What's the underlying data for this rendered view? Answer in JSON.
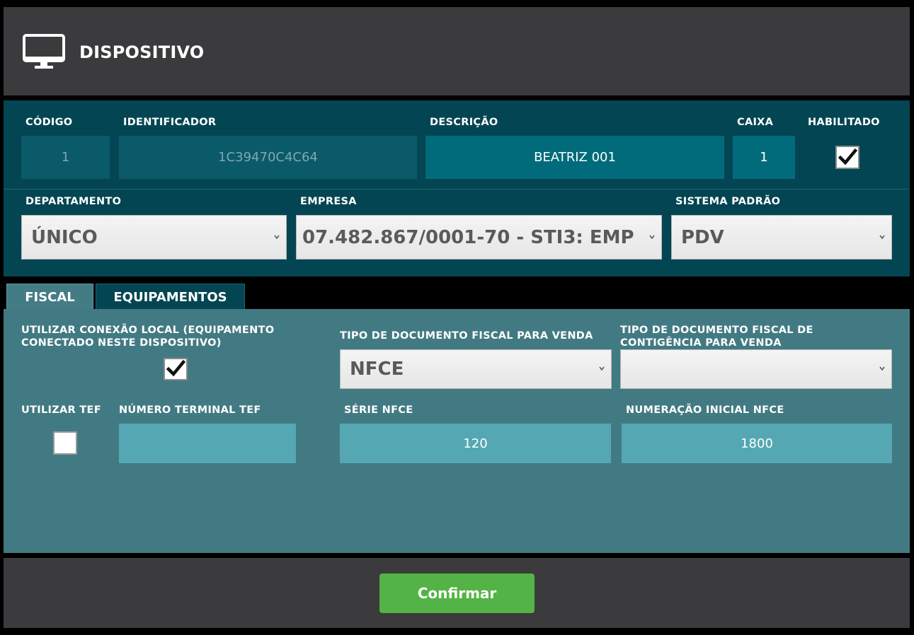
{
  "header": {
    "title": "DISPOSITIVO",
    "icon": "monitor-icon"
  },
  "device": {
    "codigo_label": "CÓDIGO",
    "codigo_value": "1",
    "identificador_label": "IDENTIFICADOR",
    "identificador_value": "1C39470C4C64",
    "descricao_label": "DESCRIÇÃO",
    "descricao_value": "BEATRIZ 001",
    "caixa_label": "CAIXA",
    "caixa_value": "1",
    "habilitado_label": "HABILITADO",
    "habilitado_checked": true,
    "departamento_label": "DEPARTAMENTO",
    "departamento_value": "ÚNICO",
    "empresa_label": "EMPRESA",
    "empresa_value": "07.482.867/0001-70  -  STI3: EMP",
    "sistema_label": "SISTEMA PADRÃO",
    "sistema_value": "PDV"
  },
  "tabs": [
    {
      "label": "FISCAL",
      "active": true
    },
    {
      "label": "EQUIPAMENTOS",
      "active": false
    }
  ],
  "fiscal": {
    "conexao_label_line1": "UTILIZAR CONEXÃO LOCAL (EQUIPAMENTO",
    "conexao_label_line2": "CONECTADO NESTE DISPOSITIVO)",
    "conexao_checked": true,
    "tipo_doc_label": "TIPO DE DOCUMENTO FISCAL PARA VENDA",
    "tipo_doc_value": "NFCE",
    "tipo_contig_label_line1": "TIPO DE DOCUMENTO FISCAL DE",
    "tipo_contig_label_line2": "CONTIGÊNCIA PARA VENDA",
    "tipo_contig_value": "",
    "tef_label": "UTILIZAR TEF",
    "tef_checked": false,
    "terminal_label": "NÚMERO TERMINAL TEF",
    "terminal_value": "",
    "serie_label": "SÉRIE NFCE",
    "serie_value": "120",
    "numeracao_label": "NUMERAÇÃO INICIAL NFCE",
    "numeracao_value": "1800"
  },
  "footer": {
    "confirm_label": "Confirmar"
  },
  "colors": {
    "header_bg": "#3b3a3c",
    "device_bg": "#034553",
    "fiscal_bg": "#427a83",
    "confirm_bg": "#54b346"
  }
}
